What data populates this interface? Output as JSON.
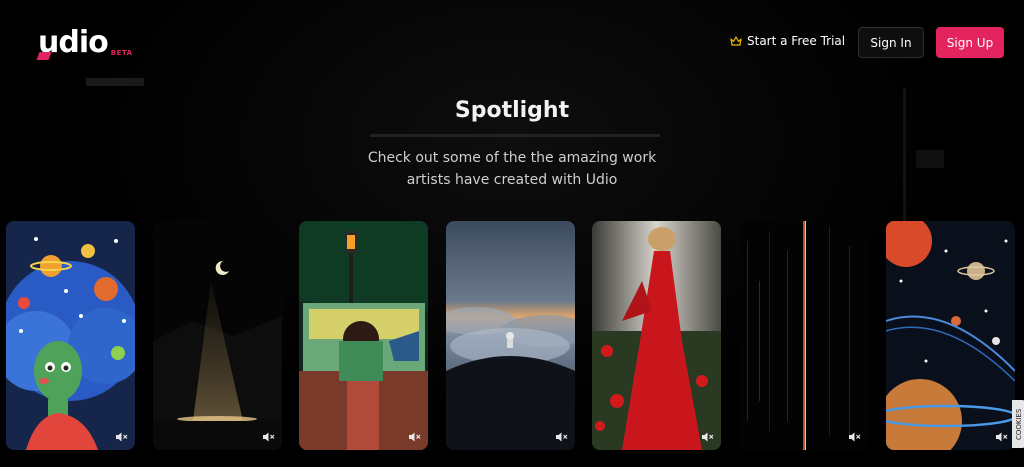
{
  "header": {
    "logo_text": "udio",
    "logo_badge": "BETA",
    "trial_label": "Start a Free Trial",
    "signin_label": "Sign In",
    "signup_label": "Sign Up"
  },
  "spotlight": {
    "title": "Spotlight",
    "subtitle": "Check out some of the the amazing work artists have created with Udio"
  },
  "cards": [
    {
      "name": "card-cosmic-girl",
      "icon": "mute-icon"
    },
    {
      "name": "card-moon-sparkles",
      "icon": "mute-icon"
    },
    {
      "name": "card-street-lamp",
      "icon": "mute-icon"
    },
    {
      "name": "card-astronaut-clouds",
      "icon": "mute-icon"
    },
    {
      "name": "card-red-dress",
      "icon": "mute-icon"
    },
    {
      "name": "card-glitch",
      "icon": "mute-icon"
    },
    {
      "name": "card-planets",
      "icon": "mute-icon"
    }
  ],
  "cookies_tab": "COOKIES",
  "colors": {
    "accent": "#e3245e",
    "background": "#000000"
  }
}
